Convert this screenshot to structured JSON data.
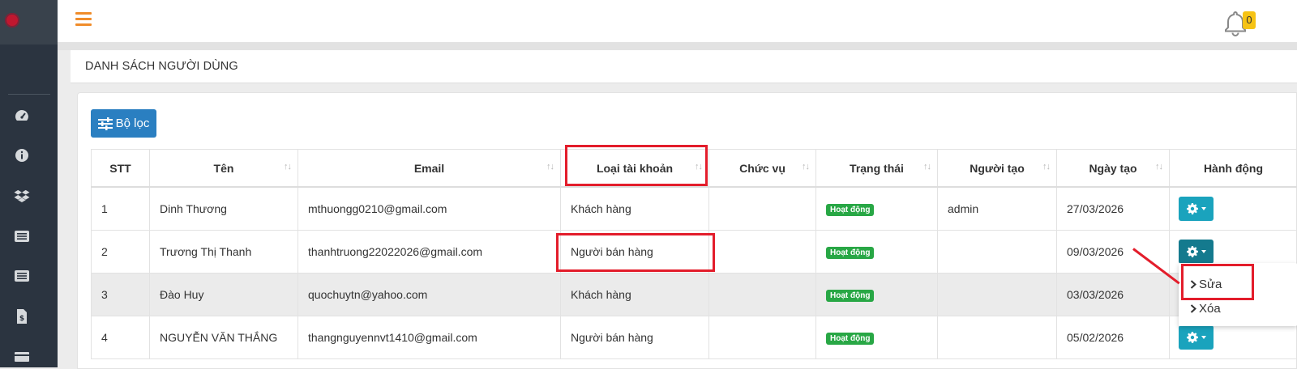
{
  "topbar": {
    "notification_count": "0"
  },
  "page": {
    "title": "DANH SÁCH NGƯỜI DÙNG"
  },
  "toolbar": {
    "filter_label": "Bộ lọc"
  },
  "table": {
    "columns": [
      "STT",
      "Tên",
      "Email",
      "Loại tài khoản",
      "Chức vụ",
      "Trạng thái",
      "Người tạo",
      "Ngày tạo",
      "Hành động"
    ],
    "rows": [
      {
        "stt": "1",
        "name": "Dinh Thương",
        "email": "mthuongg0210@gmail.com",
        "account_type": "Khách hàng",
        "position": "",
        "status": "Hoạt động",
        "creator": "admin",
        "created": "27/03/2026"
      },
      {
        "stt": "2",
        "name": "Trương Thị Thanh",
        "email": "thanhtruong22022026@gmail.com",
        "account_type": "Người bán hàng",
        "position": "",
        "status": "Hoạt động",
        "creator": "",
        "created": "09/03/2026"
      },
      {
        "stt": "3",
        "name": "Đào Huy",
        "email": "quochuytn@yahoo.com",
        "account_type": "Khách hàng",
        "position": "",
        "status": "Hoạt động",
        "creator": "",
        "created": "03/03/2026"
      },
      {
        "stt": "4",
        "name": "NGUYỄN VĂN THẮNG",
        "email": "thangnguyennvt1410@gmail.com",
        "account_type": "Người bán hàng",
        "position": "",
        "status": "Hoạt động",
        "creator": "",
        "created": "05/02/2026"
      }
    ]
  },
  "action_menu": {
    "edit_label": "Sửa",
    "delete_label": "Xóa"
  },
  "icons": {
    "sidebar": [
      "dashboard-icon",
      "info-icon",
      "dropbox-icon",
      "list-icon",
      "list-icon",
      "invoice-icon",
      "card-icon"
    ],
    "topbar": [
      "hamburger-icon",
      "bell-icon"
    ]
  },
  "colors": {
    "accent": "#2a7fc1",
    "action": "#1aa3bd",
    "status": "#28a745",
    "annotation": "#e31d2b",
    "sidebar": "#2b3440"
  }
}
